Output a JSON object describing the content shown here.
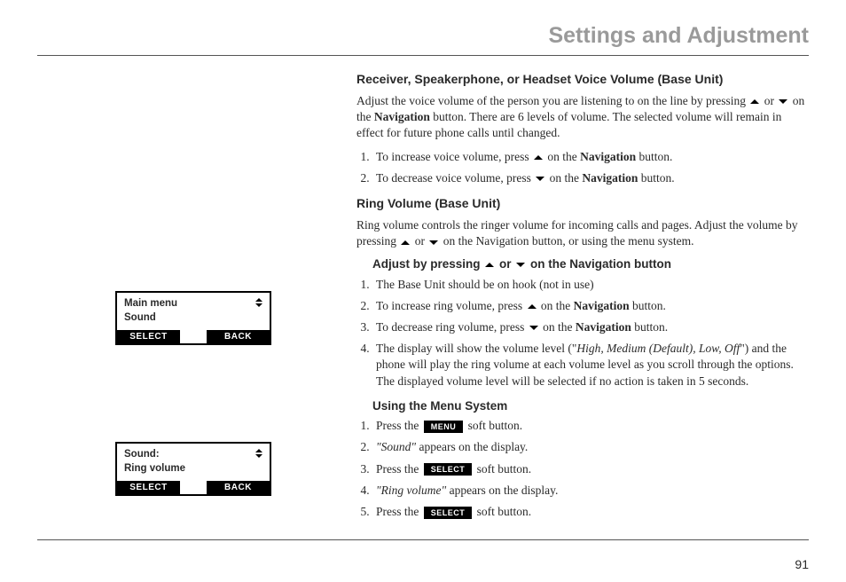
{
  "page": {
    "title": "Settings and Adjustment",
    "number": "91"
  },
  "section1": {
    "heading": "Receiver, Speakerphone, or Headset Voice Volume (Base Unit)",
    "intro_a": "Adjust the voice volume of the person you are listening to on the line by pressing ",
    "intro_b": " or ",
    "intro_c": " on the ",
    "nav": "Navigation",
    "intro_d": " button. There are 6 levels of volume. The selected volume will remain in effect for future phone calls until changed.",
    "step1_a": "To increase voice volume, press ",
    "step1_b": " on the ",
    "step1_c": " button.",
    "step2_a": "To decrease voice volume, press ",
    "step2_b": " on the ",
    "step2_c": " button."
  },
  "section2": {
    "heading": "Ring Volume (Base Unit)",
    "intro_a": "Ring volume controls the ringer volume for incoming calls and pages. Adjust the volume by pressing ",
    "intro_b": " or ",
    "intro_c": " on the Navigation button, or using the menu system.",
    "sub1_a": "Adjust by pressing ",
    "sub1_b": " or ",
    "sub1_c": " on the Navigation button",
    "s1": "The Base Unit should be on hook (not in use)",
    "s2_a": "To increase ring volume, press ",
    "s2_b": " on the ",
    "s2_c": " button.",
    "s3_a": "To decrease ring volume, press ",
    "s3_b": " on the ",
    "s3_c": " button.",
    "s4_a": "The display will show the volume level (\"",
    "s4_italic": "High, Medium (Default), Low, Off",
    "s4_b": "\") and the phone will play the ring volume at each volume level as you scroll through the options. The displayed volume level will be selected if no action is taken in 5 seconds.",
    "sub2": "Using the Menu System",
    "m1_a": "Press the ",
    "m1_btn": "MENU",
    "m1_b": " soft button.",
    "m2_a": "\"Sound\"",
    "m2_b": " appears on the display.",
    "m3_a": "Press the ",
    "m3_btn": "SELECT",
    "m3_b": " soft button.",
    "m4_a": "\"Ring volume\"",
    "m4_b": " appears on the display.",
    "m5_a": "Press the ",
    "m5_btn": "SELECT",
    "m5_b": " soft button."
  },
  "lcd1": {
    "line1": "Main menu",
    "line2": "Sound",
    "left": "SELECT",
    "right": "BACK"
  },
  "lcd2": {
    "line1": "Sound:",
    "line2": "Ring volume",
    "left": "SELECT",
    "right": "BACK"
  }
}
